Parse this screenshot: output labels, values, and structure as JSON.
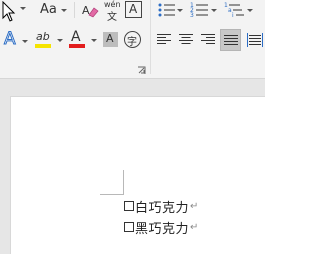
{
  "ribbon": {
    "font_size_label": "Aa",
    "pinyin_top": "wén",
    "pinyin_bottom": "文",
    "char_border_label": "A",
    "text_effect_label": "A",
    "highlight_label": "ab",
    "font_color_label": "A",
    "char_shading_label": "A",
    "enclose_char_label": "字",
    "colors": {
      "highlight": "#f5e400",
      "font_color": "#e21d1d",
      "accent_blue": "#2b6cc4",
      "selected_bg": "#c8c8c8"
    }
  },
  "document": {
    "items": [
      {
        "text": "白巧克力",
        "mark": "↵"
      },
      {
        "text": "黑巧克力",
        "mark": "↵"
      }
    ]
  }
}
